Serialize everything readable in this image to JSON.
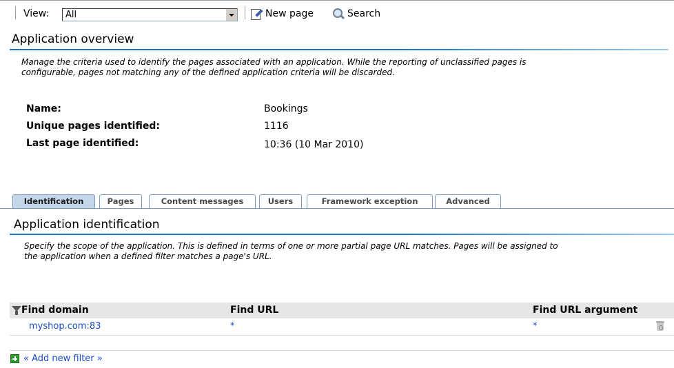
{
  "toolbar": {
    "view_label": "View:",
    "view_value": "All",
    "new_page_label": "New page",
    "search_label": "Search"
  },
  "overview": {
    "title": "Application overview",
    "description_line1": "Manage the criteria used to identify the pages associated with an application. While the reporting of unclassified pages is",
    "description_line2": "configurable, pages not matching any of the defined application criteria will be discarded.",
    "fields": [
      {
        "label": "Name:",
        "value": "Bookings"
      },
      {
        "label": "Unique pages identified:",
        "value": "1116"
      },
      {
        "label": "Last page identified:",
        "value": "10:36 (10 Mar 2010)"
      }
    ]
  },
  "tabs": [
    {
      "label": "Identification",
      "active": true
    },
    {
      "label": "Pages",
      "active": false
    },
    {
      "label": "Content messages",
      "active": false
    },
    {
      "label": "Users",
      "active": false
    },
    {
      "label": "Framework exception",
      "active": false
    },
    {
      "label": "Advanced",
      "active": false
    }
  ],
  "identification": {
    "title": "Application identification",
    "description_line1": "Specify the scope of the application. This is defined in terms of one or more partial page URL matches. Pages will be assigned to",
    "description_line2": "the application when a defined filter matches a page's URL.",
    "columns": [
      "Find domain",
      "Find URL",
      "Find URL argument"
    ],
    "rows": [
      {
        "domain": "myshop.com:83",
        "url": "*",
        "argument": "*"
      }
    ],
    "add_filter_label": "« Add new filter »"
  },
  "icons": {
    "new_page": "new-page-icon",
    "search": "search-icon",
    "filter": "filter-icon",
    "delete": "trash-icon",
    "add": "add-icon"
  },
  "colors": {
    "accent_rule": "#1e78c8",
    "active_tab": "#c5d5ea",
    "link": "#1a4cc8"
  }
}
